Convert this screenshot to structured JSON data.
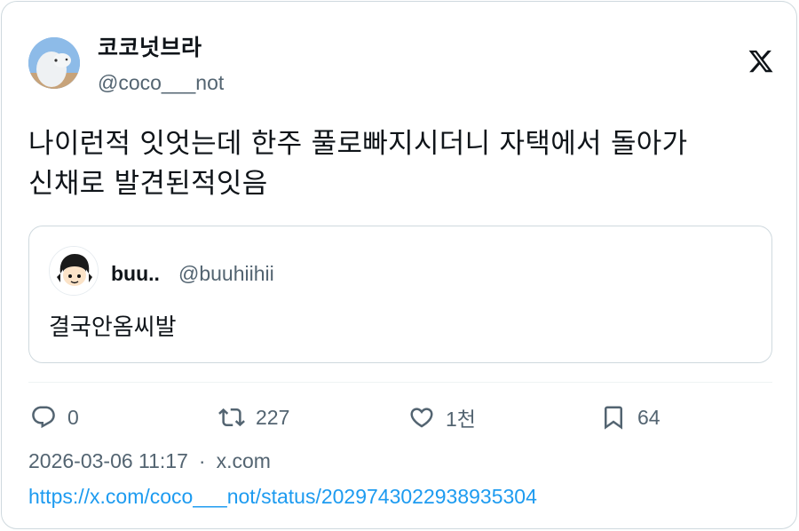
{
  "author": {
    "display_name": "코코넛브라",
    "handle": "@coco___not"
  },
  "tweet": {
    "text_line1": "나이런적 잇엇는데 한주 풀로빠지시더니 자택에서 돌아가",
    "text_line2": "신채로 발견된적잇음"
  },
  "quote": {
    "display_name": "buu..",
    "handle": "@buuhiihii",
    "text": "결국안옴씨발"
  },
  "actions": {
    "reply_count": "0",
    "retweet_count": "227",
    "like_count": "1천",
    "bookmark_count": "64"
  },
  "meta": {
    "timestamp": "2026-03-06 11:17",
    "separator": "·",
    "source": "x.com"
  },
  "link": {
    "url": "https://x.com/coco___not/status/2029743022938935304"
  },
  "icons": {
    "brand": "x-logo-icon",
    "reply": "speech-bubble-icon",
    "retweet": "retweet-arrows-icon",
    "like": "heart-icon",
    "bookmark": "bookmark-icon"
  },
  "colors": {
    "text": "#0f1419",
    "muted": "#536471",
    "link": "#1d9bf0",
    "border": "#cfd9de"
  }
}
